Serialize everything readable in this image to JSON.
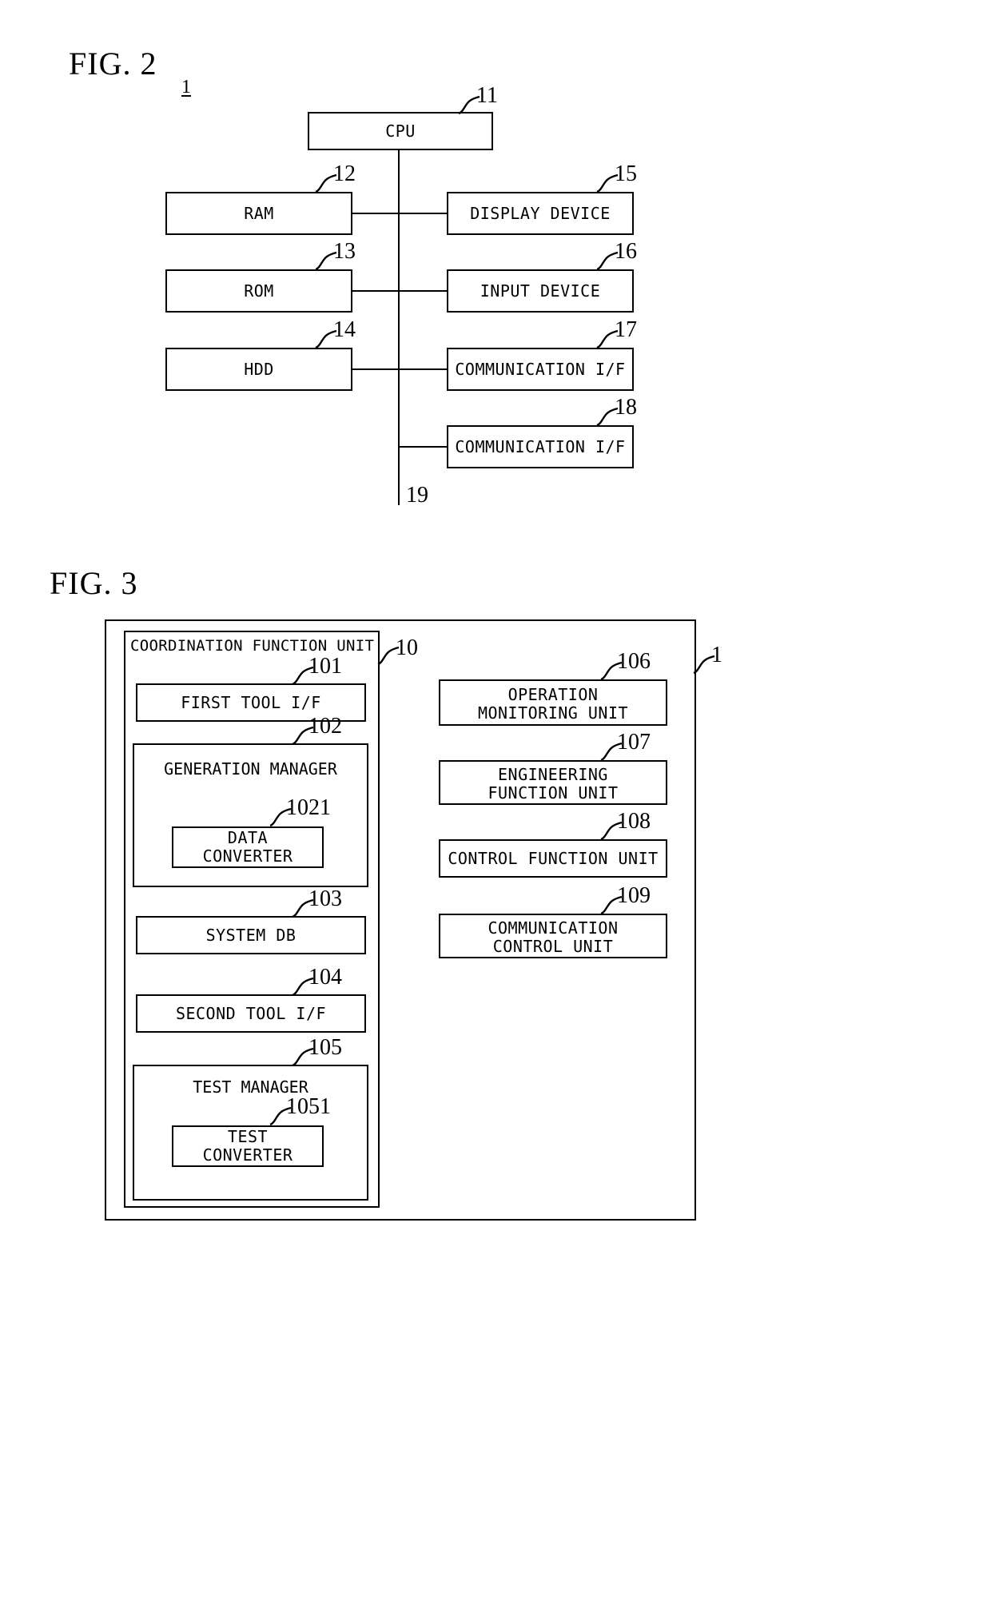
{
  "figures": {
    "fig2": {
      "title": "FIG. 2",
      "subscript": "1",
      "blocks": [
        {
          "id": "cpu",
          "label": "CPU",
          "ref": "11"
        },
        {
          "id": "ram",
          "label": "RAM",
          "ref": "12"
        },
        {
          "id": "rom",
          "label": "ROM",
          "ref": "13"
        },
        {
          "id": "hdd",
          "label": "HDD",
          "ref": "14"
        },
        {
          "id": "display",
          "label": "DISPLAY DEVICE",
          "ref": "15"
        },
        {
          "id": "input",
          "label": "INPUT DEVICE",
          "ref": "16"
        },
        {
          "id": "comm1",
          "label": "COMMUNICATION I/F",
          "ref": "17"
        },
        {
          "id": "comm2",
          "label": "COMMUNICATION I/F",
          "ref": "18"
        }
      ],
      "bus_ref": "19"
    },
    "fig3": {
      "title": "FIG. 3",
      "system_ref": "1",
      "coordination_unit": {
        "label": "COORDINATION FUNCTION UNIT",
        "ref": "10",
        "children": [
          {
            "id": "first_tool_if",
            "label": "FIRST TOOL I/F",
            "ref": "101"
          },
          {
            "id": "generation_manager",
            "label": "GENERATION MANAGER",
            "ref": "102",
            "child": {
              "id": "data_converter",
              "label": "DATA CONVERTER",
              "ref": "1021"
            }
          },
          {
            "id": "system_db",
            "label": "SYSTEM DB",
            "ref": "103"
          },
          {
            "id": "second_tool_if",
            "label": "SECOND TOOL I/F",
            "ref": "104"
          },
          {
            "id": "test_manager",
            "label": "TEST MANAGER",
            "ref": "105",
            "child": {
              "id": "test_converter",
              "label": "TEST CONVERTER",
              "ref": "1051"
            }
          }
        ]
      },
      "right_units": [
        {
          "id": "operation_monitoring",
          "line1": "OPERATION",
          "line2": "MONITORING UNIT",
          "ref": "106"
        },
        {
          "id": "engineering_function",
          "line1": "ENGINEERING",
          "line2": "FUNCTION UNIT",
          "ref": "107"
        },
        {
          "id": "control_function",
          "line1": "CONTROL FUNCTION UNIT",
          "line2": "",
          "ref": "108"
        },
        {
          "id": "communication_control",
          "line1": "COMMUNICATION",
          "line2": "CONTROL UNIT",
          "ref": "109"
        }
      ]
    }
  },
  "colors": {
    "ink": "#000000",
    "paper": "#ffffff"
  }
}
